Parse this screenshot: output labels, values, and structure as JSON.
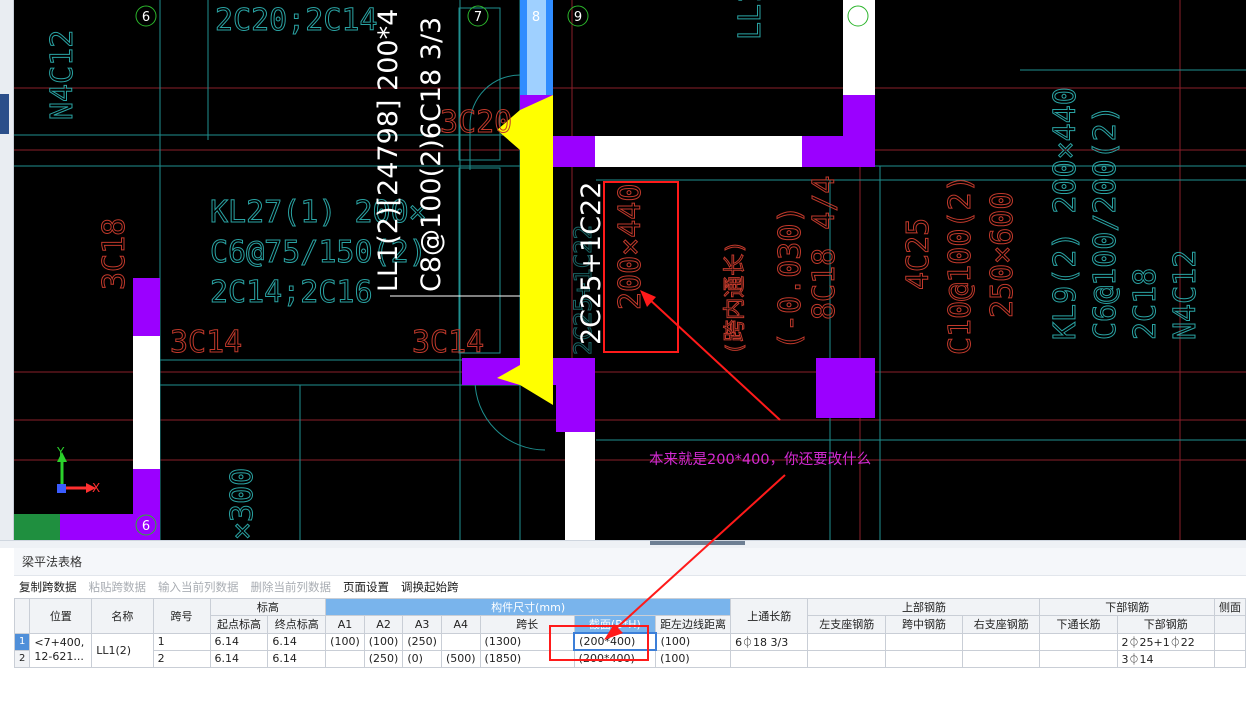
{
  "colors": {
    "cad_bg": "#000000",
    "cyan": "#2aa3a3",
    "red_label": "#c0392b",
    "magenta_col": "#9b00ff",
    "yellow": "#ffff00",
    "annotation_red": "#ff1a1a",
    "comment": "#d22ad2"
  },
  "cad": {
    "axis_labels": [
      "6",
      "7",
      "8",
      "9",
      "6"
    ],
    "texts": {
      "top_2c20": "2C20;2C14",
      "top_n4c12": "N4C12",
      "top_ll1_cols": "LL1 C8 6C",
      "kl27_1": "KL27(1) 200×",
      "kl27_2": "C6@75/150(2)",
      "kl27_3": "2C14;2C16",
      "left_3c18": "3C18",
      "label_3c14_a": "3C14",
      "label_3c14_b": "3C14",
      "label_3c20": "3C20",
      "ll1_line1": "LL1(2)[24798] 200*4",
      "ll1_line2": "C8@100(2)6C18 3/3",
      "rebar_2c25": "2C25+1C22",
      "size_200x440": "200×440",
      "ghost_2c25": "2C25+1C22",
      "kuanei": "(跨内通长)",
      "elev": "(-0.030)",
      "c8c18": "8C18 4/4",
      "c4c25": "4C25",
      "c10": "C10@100(2)",
      "s250": "250×600",
      "kl9_1": "KL9(2) 200×440",
      "kl9_2": "C6@100/200(2)",
      "kl9_3": "2C18",
      "kl9_4": "N4C12",
      "x300": "×300",
      "ucs_y": "Y",
      "ucs_x": "X"
    }
  },
  "annotation": {
    "comment": "本来就是200*400，你还要改什么"
  },
  "panel": {
    "title": "梁平法表格",
    "toolbar": [
      {
        "label": "复制跨数据",
        "enabled": true
      },
      {
        "label": "粘贴跨数据",
        "enabled": false
      },
      {
        "label": "输入当前列数据",
        "enabled": false
      },
      {
        "label": "删除当前列数据",
        "enabled": false
      },
      {
        "label": "页面设置",
        "enabled": true
      },
      {
        "label": "调换起始跨",
        "enabled": true
      }
    ],
    "headers": {
      "pos": "位置",
      "name": "名称",
      "span": "跨号",
      "elev": "标高",
      "start_elev": "起点标高",
      "end_elev": "终点标高",
      "size_group": "构件尺寸(mm)",
      "a1": "A1",
      "a2": "A2",
      "a3": "A3",
      "a4": "A4",
      "span_len": "跨长",
      "section": "截面(B*H)",
      "offset": "距左边线距离",
      "top_through": "上通长筋",
      "top_group": "上部钢筋",
      "left_support": "左支座钢筋",
      "mid_span": "跨中钢筋",
      "right_support": "右支座钢筋",
      "bottom_group": "下部钢筋",
      "bottom_through": "下通长筋",
      "bottom_bar": "下部钢筋",
      "side": "侧面"
    },
    "row_numbers": [
      "1",
      "2"
    ],
    "rows": [
      {
        "pos": "<7+400, 12-621...",
        "name": "LL1(2)",
        "span": "1",
        "start_elev": "6.14",
        "end_elev": "6.14",
        "a1": "(100)",
        "a2": "(100)",
        "a3": "(250)",
        "a4": "",
        "span_len": "(1300)",
        "section": "(200*400)",
        "offset": "(100)",
        "top_through": "6⏀18 3/3",
        "left_support": "",
        "mid_span": "",
        "right_support": "",
        "bottom_through": "",
        "bottom_bar": "2⏀25+1⏀22"
      },
      {
        "pos": "",
        "name": "",
        "span": "2",
        "start_elev": "6.14",
        "end_elev": "6.14",
        "a1": "",
        "a2": "(250)",
        "a3": "(0)",
        "a4": "(500)",
        "span_len": "(1850)",
        "section": "(200*400)",
        "offset": "(100)",
        "top_through": "",
        "left_support": "",
        "mid_span": "",
        "right_support": "",
        "bottom_through": "",
        "bottom_bar": "3⏀14"
      }
    ]
  }
}
